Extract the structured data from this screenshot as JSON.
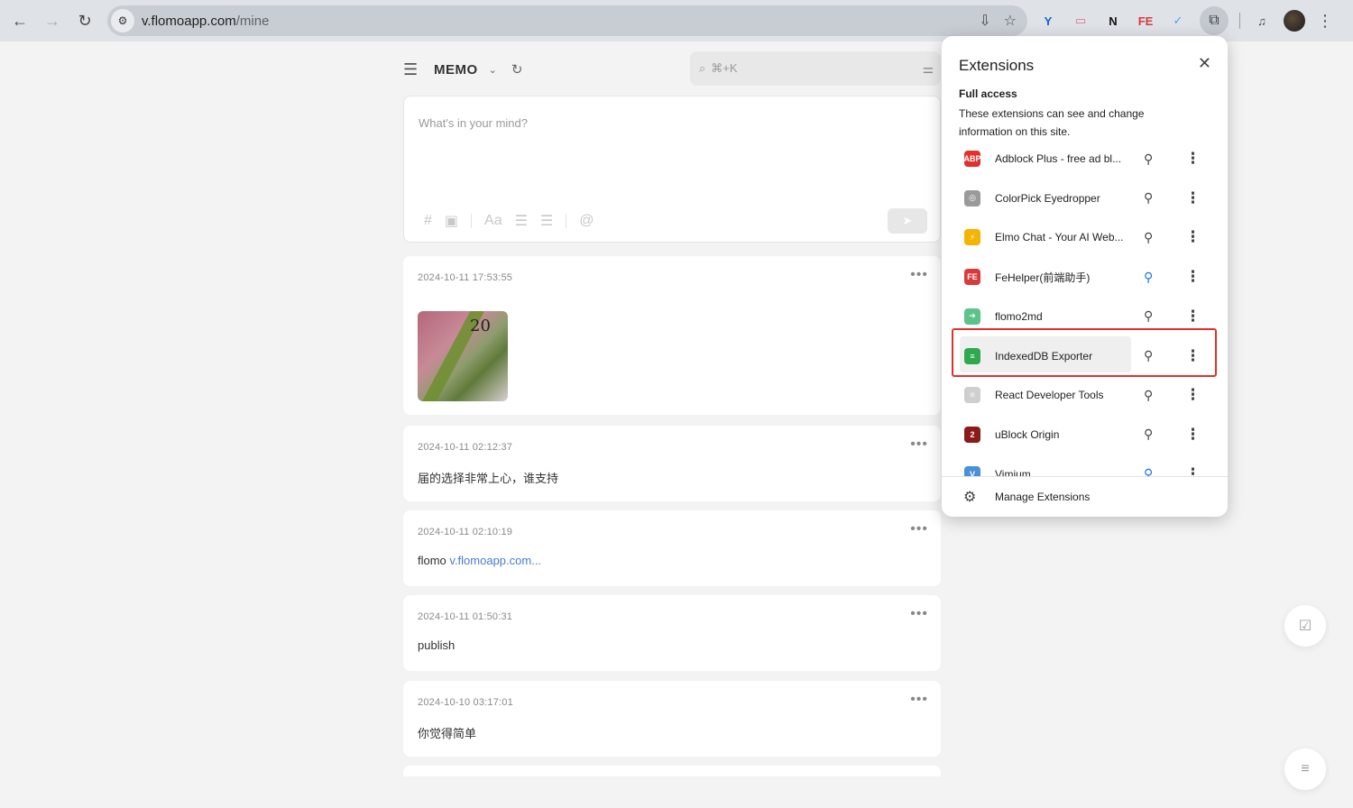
{
  "browser": {
    "url_host": "v.flomoapp.com",
    "url_path": "/mine",
    "nav": {
      "back_icon": "←",
      "forward_icon": "→",
      "reload_icon": "↻"
    },
    "omni_icons": [
      "⇩",
      "☆"
    ],
    "extension_icons": [
      {
        "glyph": "Y",
        "color": "#1a5fd0"
      },
      {
        "glyph": "▭",
        "color": "#e06d86"
      },
      {
        "glyph": "N",
        "color": "#111111"
      },
      {
        "glyph": "FE",
        "color": "#d93a3a"
      },
      {
        "glyph": "✓",
        "color": "#4aa2e8"
      }
    ],
    "puzzle_icon": "⧉",
    "media_icon": "♫",
    "menu_icon": "⋮"
  },
  "memo": {
    "title": "MEMO",
    "caret": "⌄",
    "refresh": "↻",
    "search_placeholder": "⌘+K",
    "editor_placeholder": "What's in your mind?",
    "tools": [
      "#",
      "▣",
      "Aa",
      "☰",
      "☰",
      "@"
    ],
    "send": "➤"
  },
  "cards": [
    {
      "time": "2024-10-11 17:53:55",
      "text": "",
      "has_image": true,
      "image_text": "20"
    },
    {
      "time": "2024-10-11 02:12:37",
      "text": "届的选择非常上心，谁支持"
    },
    {
      "time": "2024-10-11 02:10:19",
      "text": "flomo ",
      "link": "v.flomoapp.com..."
    },
    {
      "time": "2024-10-11 01:50:31",
      "text": "publish"
    },
    {
      "time": "2024-10-10 03:17:01",
      "text": "你觉得简单"
    }
  ],
  "more_icon": "•••",
  "fab": {
    "check": "☑",
    "list": "≡"
  },
  "extensions_popup": {
    "title": "Extensions",
    "close": "✕",
    "section_title": "Full access",
    "section_desc": "These extensions can see and change information on this site.",
    "items": [
      {
        "name": "Adblock Plus - free ad bl...",
        "icon": "ABP",
        "icon_color": "#e0312e",
        "pinned": false
      },
      {
        "name": "ColorPick Eyedropper",
        "icon": "◎",
        "icon_color": "#9a9a9a",
        "pinned": false
      },
      {
        "name": "Elmo Chat - Your AI Web...",
        "icon": "⚡",
        "icon_color": "#f4b400",
        "pinned": false
      },
      {
        "name": "FeHelper(前端助手)",
        "icon": "FE",
        "icon_color": "#d93a3a",
        "pinned": true
      },
      {
        "name": "flomo2md",
        "icon": "➜",
        "icon_color": "#5cc48a",
        "pinned": false
      },
      {
        "name": "IndexedDB Exporter",
        "icon": "≡",
        "icon_color": "#2fa84f",
        "pinned": false,
        "highlighted": true
      },
      {
        "name": "React Developer Tools",
        "icon": "⚛",
        "icon_color": "#cfcfcf",
        "pinned": false
      },
      {
        "name": "uBlock Origin",
        "icon": "2",
        "icon_color": "#8b1a1a",
        "pinned": false
      },
      {
        "name": "Vimium",
        "icon": "V",
        "icon_color": "#4a90d9",
        "pinned": true
      }
    ],
    "pin_icon": "📌",
    "dots_icon": "⋮",
    "manage_label": "Manage Extensions",
    "manage_icon": "⚙"
  },
  "highlight_color": "#e0312e"
}
